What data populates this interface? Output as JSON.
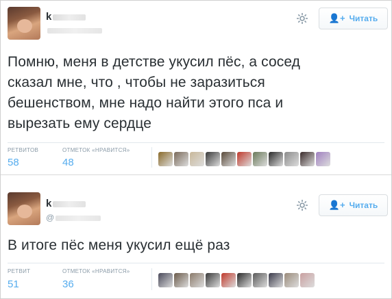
{
  "tweets": [
    {
      "name_visible": "k",
      "handle_visible": "",
      "follow_label": "Читать",
      "text_lines": [
        "Помню, меня в детстве укусил пёс, а сосед",
        "сказал мне, что , чтобы не заразиться",
        "бешенством, мне надо найти этого пса и",
        "вырезать ему сердце"
      ],
      "retweets_label": "РЕТВИТОВ",
      "retweets_count": "58",
      "likes_label": "ОТМЕТОК «НРАВИТСЯ»",
      "likes_count": "48",
      "likers": [
        "#8a6a2a",
        "#7a6a5a",
        "#c9b89a",
        "#3a3a3a",
        "#5a4a3a",
        "#c0392b",
        "#6a7a5a",
        "#2a2a2a",
        "#8a8a8a",
        "#3a2a2a",
        "#a080c0"
      ]
    },
    {
      "name_visible": "k",
      "handle_visible": "@",
      "follow_label": "Читать",
      "text_lines": [
        "В итоге пёс меня укусил ещё раз"
      ],
      "retweets_label": "РЕТВИТ",
      "retweets_count": "51",
      "likes_label": "ОТМЕТОК «НРАВИТСЯ»",
      "likes_count": "36",
      "likers": [
        "#4a4a5a",
        "#6a5a4a",
        "#8a7a6a",
        "#3a3a3a",
        "#c0392b",
        "#2a2a2a",
        "#5a5a5a",
        "#3a3a4a",
        "#9a8a7a",
        "#c9a0a0"
      ]
    }
  ]
}
